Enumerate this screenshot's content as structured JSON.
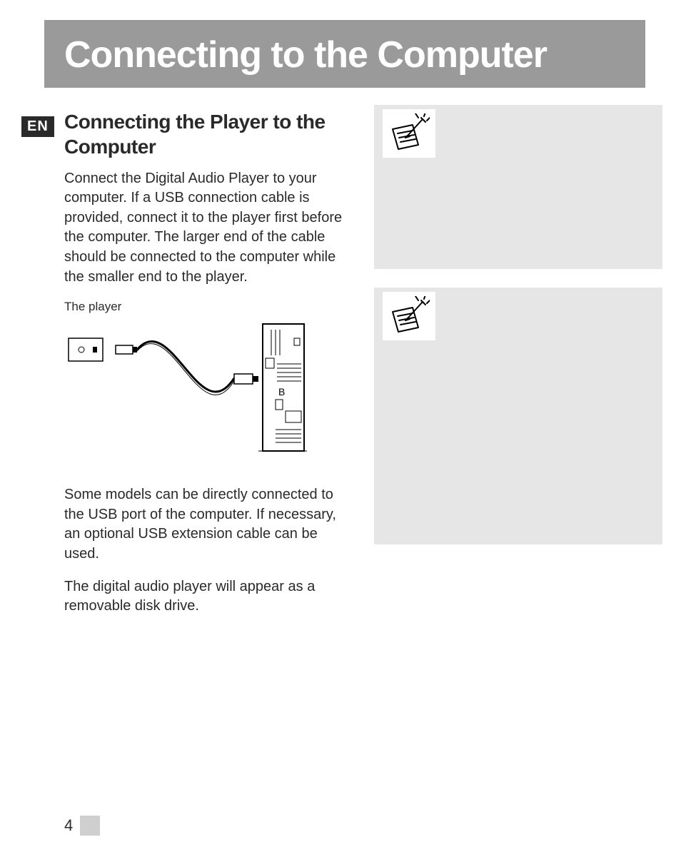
{
  "header": {
    "title": "Connecting to the Computer",
    "lang_badge": "EN"
  },
  "left": {
    "heading": "Connecting the Player to the Computer",
    "p1": "Connect the Digital Audio Player to your computer. If a USB connection cable is provided, connect it to the player first before the computer. The larger end of the cable should be connected to the computer while the smaller end to the player.",
    "figure_label": "The player",
    "p2": "Some models can be directly connected to the USB port of the computer. If necessary, an optional USB extension cable can be used.",
    "p3": "The digital audio player will appear as a removable disk drive."
  },
  "right": {
    "note1": "",
    "note2": ""
  },
  "footer": {
    "page_number": "4"
  },
  "icons": {
    "note": "pencil-note-icon"
  }
}
